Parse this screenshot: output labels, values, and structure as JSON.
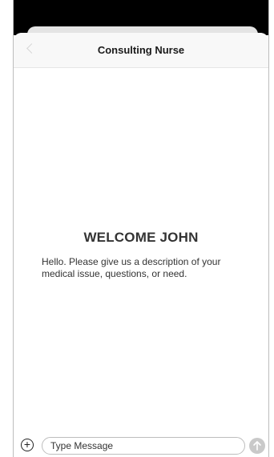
{
  "header": {
    "title": "Consulting Nurse"
  },
  "main": {
    "welcome_heading": "WELCOME JOHN",
    "intro_text": "Hello. Please give us a description of your medical issue, questions, or need."
  },
  "composer": {
    "placeholder": "Type Message",
    "add_icon": "plus-circle-icon",
    "send_icon": "arrow-up-circle-icon"
  },
  "colors": {
    "header_background": "#f8f8f8",
    "status_bar": "#000000",
    "send_button_disabled": "#c9c9c9",
    "text": "#333333"
  }
}
